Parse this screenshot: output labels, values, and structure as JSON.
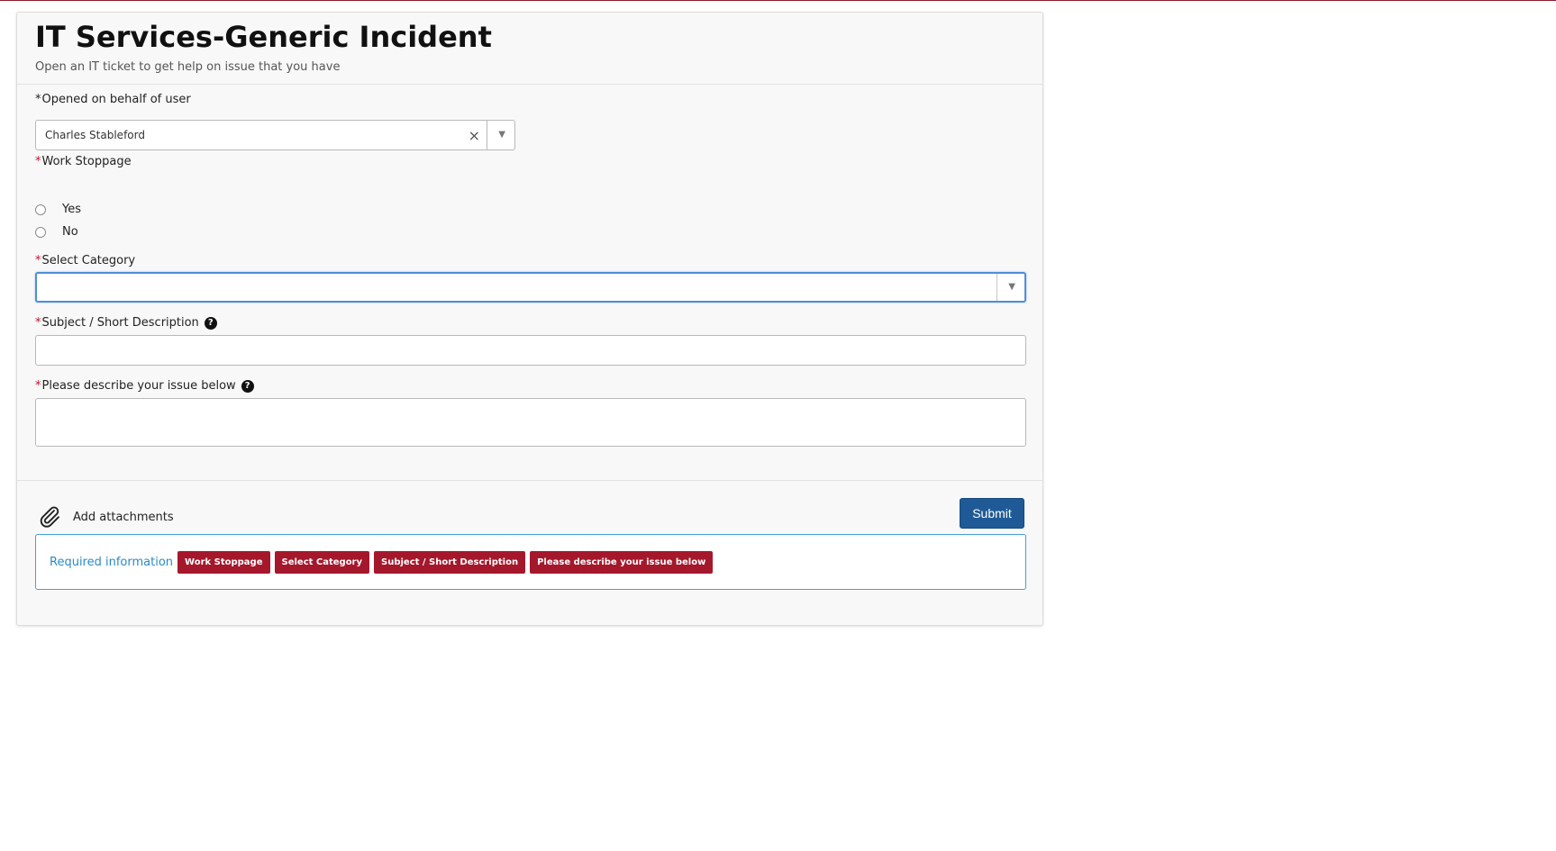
{
  "form": {
    "title": "IT Services-Generic Incident",
    "subtitle": "Open an IT ticket to get help on issue that you have"
  },
  "fields": {
    "opened_on_behalf": {
      "label": "Opened on behalf of user",
      "value": "Charles Stableford",
      "clear_symbol": "×",
      "arrow_symbol": "▼"
    },
    "work_stoppage": {
      "label": "Work Stoppage",
      "options": [
        "Yes",
        "No"
      ]
    },
    "category": {
      "label": "Select Category",
      "value": "",
      "arrow_symbol": "▼"
    },
    "subject": {
      "label": "Subject / Short Description",
      "value": ""
    },
    "description": {
      "label": "Please describe your issue below",
      "value": ""
    },
    "help_symbol": "?",
    "required_mark": "*"
  },
  "footer": {
    "attachments_label": "Add attachments",
    "submit_label": "Submit",
    "required_info_label": "Required information",
    "required_badges": [
      "Work Stoppage",
      "Select Category",
      "Subject / Short Description",
      "Please describe your issue below"
    ]
  },
  "colors": {
    "accent_red": "#a5182c",
    "required_red": "#c8102e",
    "submit_blue": "#1f5a96",
    "info_blue": "#2a8ac7",
    "focus_blue": "#4f8fd6"
  },
  "icons": {
    "attachment": "paperclip-icon",
    "help": "question-circle-icon"
  }
}
